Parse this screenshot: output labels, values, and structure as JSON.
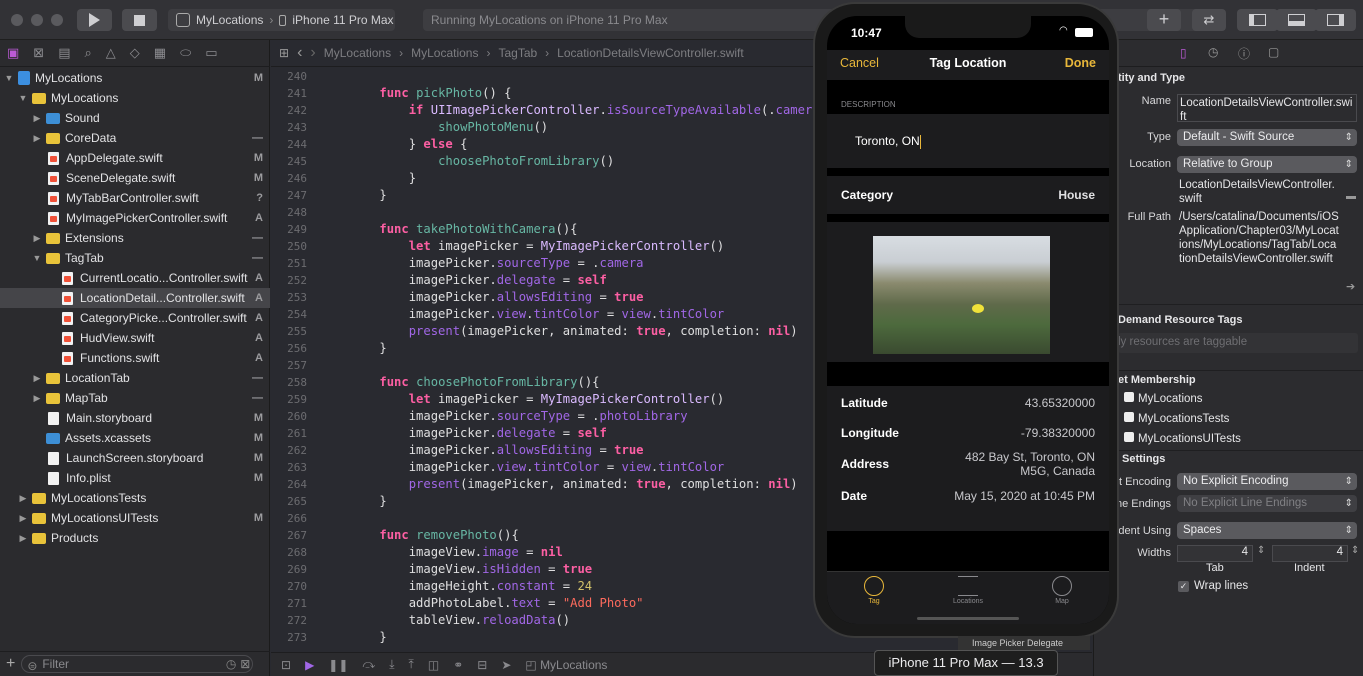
{
  "toolbar": {
    "scheme": "MyLocations",
    "device": "iPhone 11 Pro Max",
    "activity": "Running MyLocations on iPhone 11 Pro Max"
  },
  "jumpbar": {
    "crumbs": [
      "MyLocations",
      "MyLocations",
      "TagTab",
      "LocationDetailsViewController.swift"
    ]
  },
  "navigator": {
    "items": [
      {
        "label": "MyLocations",
        "status": "M"
      },
      {
        "label": "MyLocations",
        "status": ""
      },
      {
        "label": "Sound",
        "status": ""
      },
      {
        "label": "CoreData",
        "status": "—"
      },
      {
        "label": "AppDelegate.swift",
        "status": "M"
      },
      {
        "label": "SceneDelegate.swift",
        "status": "M"
      },
      {
        "label": "MyTabBarController.swift",
        "status": "?"
      },
      {
        "label": "MyImagePickerController.swift",
        "status": "A"
      },
      {
        "label": "Extensions",
        "status": "—"
      },
      {
        "label": "TagTab",
        "status": "—"
      },
      {
        "label": "CurrentLocatio...Controller.swift",
        "status": "A"
      },
      {
        "label": "LocationDetail...Controller.swift",
        "status": "A"
      },
      {
        "label": "CategoryPicke...Controller.swift",
        "status": "A"
      },
      {
        "label": "HudView.swift",
        "status": "A"
      },
      {
        "label": "Functions.swift",
        "status": "A"
      },
      {
        "label": "LocationTab",
        "status": "—"
      },
      {
        "label": "MapTab",
        "status": "—"
      },
      {
        "label": "Main.storyboard",
        "status": "M"
      },
      {
        "label": "Assets.xcassets",
        "status": "M"
      },
      {
        "label": "LaunchScreen.storyboard",
        "status": "M"
      },
      {
        "label": "Info.plist",
        "status": "M"
      },
      {
        "label": "MyLocationsTests",
        "status": ""
      },
      {
        "label": "MyLocationsUITests",
        "status": "M"
      },
      {
        "label": "Products",
        "status": ""
      }
    ],
    "filter_placeholder": "Filter"
  },
  "code": {
    "line_numbers": [
      "240",
      "241",
      "242",
      "243",
      "244",
      "245",
      "246",
      "247",
      "248",
      "249",
      "250",
      "251",
      "252",
      "253",
      "254",
      "255",
      "256",
      "257",
      "258",
      "259",
      "260",
      "261",
      "262",
      "263",
      "264",
      "265",
      "266",
      "267",
      "268",
      "269",
      "270",
      "271",
      "272",
      "273"
    ]
  },
  "debugbar": {
    "target": "MyLocations"
  },
  "inspector": {
    "identity_header": "tity and Type",
    "name_label": "Name",
    "name_value": "LocationDetailsViewController.swift",
    "type_label": "Type",
    "type_value": "Default - Swift Source",
    "location_label": "Location",
    "location_value": "Relative to Group",
    "location_file": "LocationDetailsViewController.swift",
    "fullpath_label": "Full Path",
    "fullpath_value": "/Users/catalina/Documents/iOS Application/Chapter03/MyLocations/MyLocations/TagTab/LocationDetailsViewController.swift",
    "odr_header": "Demand Resource Tags",
    "odr_placeholder": "ly resources are taggable",
    "target_header": "et Membership",
    "targets": [
      "MyLocations",
      "MyLocationsTests",
      "MyLocationsUITests"
    ],
    "text_header": "Settings",
    "encoding_label": "t Encoding",
    "encoding_value": "No Explicit Encoding",
    "endings_label": "ne Endings",
    "endings_value": "No Explicit Line Endings",
    "indent_label": "ndent Using",
    "indent_value": "Spaces",
    "widths_label": "Widths",
    "tab_value": "4",
    "indent_width_value": "4",
    "tab_label": "Tab",
    "indent_label2": "Indent",
    "wrap_label": "Wrap lines"
  },
  "simulator": {
    "time": "10:47",
    "nav_cancel": "Cancel",
    "nav_title": "Tag Location",
    "nav_done": "Done",
    "desc_header": "DESCRIPTION",
    "desc_value": "Toronto, ON",
    "category_label": "Category",
    "category_value": "House",
    "latitude_label": "Latitude",
    "latitude_value": "43.65320000",
    "longitude_label": "Longitude",
    "longitude_value": "-79.38320000",
    "address_label": "Address",
    "address_value_1": "482 Bay St, Toronto, ON",
    "address_value_2": "M5G, Canada",
    "date_label": "Date",
    "date_value": "May 15, 2020 at 10:45 PM",
    "tabs": [
      "Tag",
      "Locations",
      "Map"
    ]
  },
  "device_tooltip": "iPhone 11 Pro Max — 13.3",
  "image_picker_tag": "Image Picker Delegate"
}
